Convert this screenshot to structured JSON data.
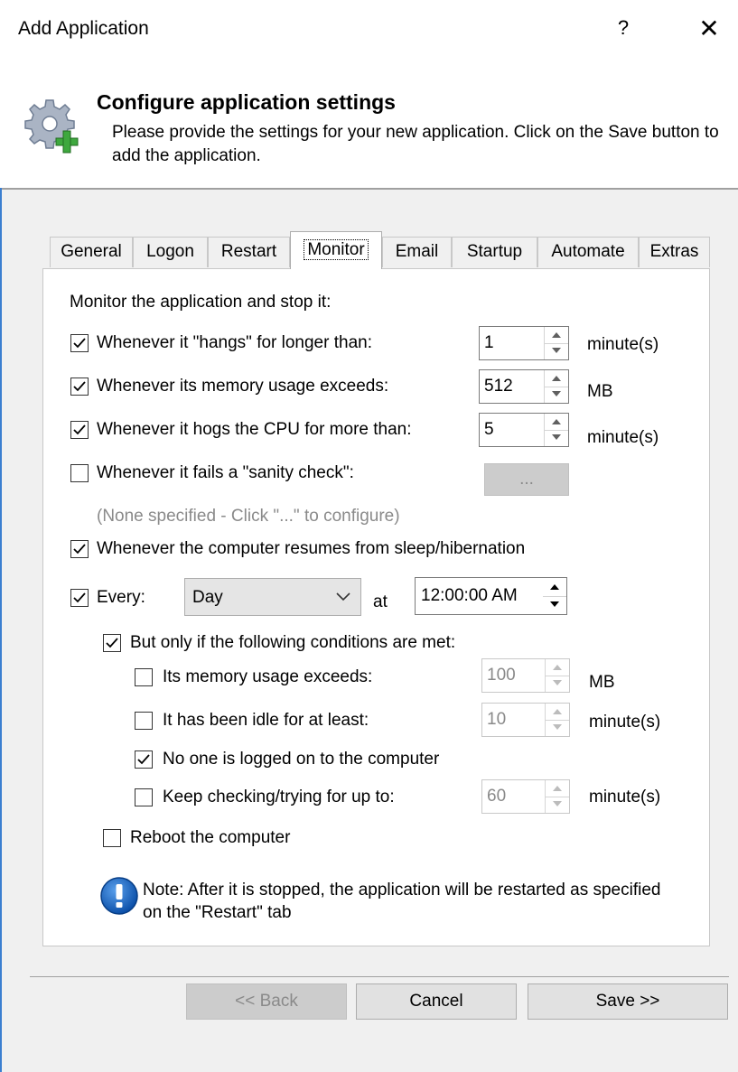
{
  "window": {
    "title": "Add Application",
    "help_label": "?",
    "close_label": "✕"
  },
  "header": {
    "title": "Configure application settings",
    "description": "Please provide the settings for your new application. Click on the Save button to add the application."
  },
  "tabs": [
    "General",
    "Logon",
    "Restart",
    "Monitor",
    "Email",
    "Startup",
    "Automate",
    "Extras"
  ],
  "active_tab": "Monitor",
  "monitor": {
    "intro": "Monitor the application and stop it:",
    "hangs": {
      "label": "Whenever it \"hangs\" for longer than:",
      "checked": true,
      "value": "1",
      "unit": "minute(s)"
    },
    "memory": {
      "label": "Whenever its memory usage exceeds:",
      "checked": true,
      "value": "512",
      "unit": "MB"
    },
    "cpu": {
      "label": "Whenever it hogs the CPU for more than:",
      "checked": true,
      "value": "5",
      "unit": "minute(s)"
    },
    "sanity": {
      "label": "Whenever it fails a \"sanity check\":",
      "checked": false,
      "button_label": "...",
      "hint": "(None specified - Click \"...\" to configure)"
    },
    "resume": {
      "label": "Whenever the computer resumes from sleep/hibernation",
      "checked": true
    },
    "every": {
      "label": "Every:",
      "checked": true,
      "period": "Day",
      "at_label": "at",
      "time": "12:00:00 AM"
    },
    "conditions": {
      "label": "But only if the following conditions are met:",
      "checked": true,
      "memory": {
        "label": "Its memory usage exceeds:",
        "checked": false,
        "value": "100",
        "unit": "MB"
      },
      "idle": {
        "label": "It has been idle for at least:",
        "checked": false,
        "value": "10",
        "unit": "minute(s)"
      },
      "nologon": {
        "label": "No one is logged on to the computer",
        "checked": true
      },
      "keep": {
        "label": "Keep checking/trying for up to:",
        "checked": false,
        "value": "60",
        "unit": "minute(s)"
      }
    },
    "reboot": {
      "label": "Reboot the computer",
      "checked": false
    },
    "note": "Note: After it is stopped, the application will be restarted as specified on the \"Restart\" tab"
  },
  "buttons": {
    "back": "<< Back",
    "cancel": "Cancel",
    "save": "Save >>"
  },
  "icons": {
    "header": "gear-plus-icon",
    "note": "info-exclamation-icon"
  },
  "colors": {
    "accent": "#3b7fd0",
    "note_icon": "#1565c0"
  }
}
